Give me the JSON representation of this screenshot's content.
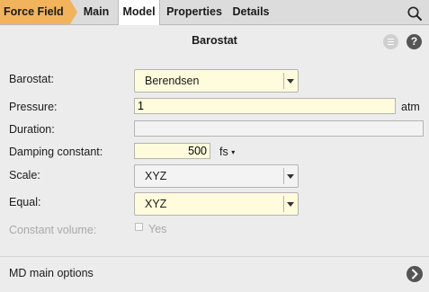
{
  "tabs": {
    "force_field": "Force Field",
    "main": "Main",
    "model": "Model",
    "properties": "Properties",
    "details": "Details"
  },
  "panel": {
    "title": "Barostat"
  },
  "fields": {
    "barostat": {
      "label": "Barostat:",
      "value": "Berendsen"
    },
    "pressure": {
      "label": "Pressure:",
      "value": "1",
      "unit": "atm"
    },
    "duration": {
      "label": "Duration:",
      "value": ""
    },
    "damping": {
      "label": "Damping constant:",
      "value": "500",
      "unit": "fs"
    },
    "scale": {
      "label": "Scale:",
      "value": "XYZ"
    },
    "equal": {
      "label": "Equal:",
      "value": "XYZ"
    },
    "constant_volume": {
      "label": "Constant volume:",
      "option": "Yes",
      "checked": false
    }
  },
  "footer": {
    "label": "MD main options"
  },
  "colors": {
    "force_field_tab": "#f1b35c",
    "input_yellow": "#fffbdc",
    "background": "#ececec"
  },
  "icons": {
    "search": "search-icon",
    "menu": "menu-icon",
    "help": "help-icon",
    "dropdown": "chevron-down-icon",
    "unit_dropdown": "triangle-down-icon",
    "next": "chevron-right-icon"
  }
}
